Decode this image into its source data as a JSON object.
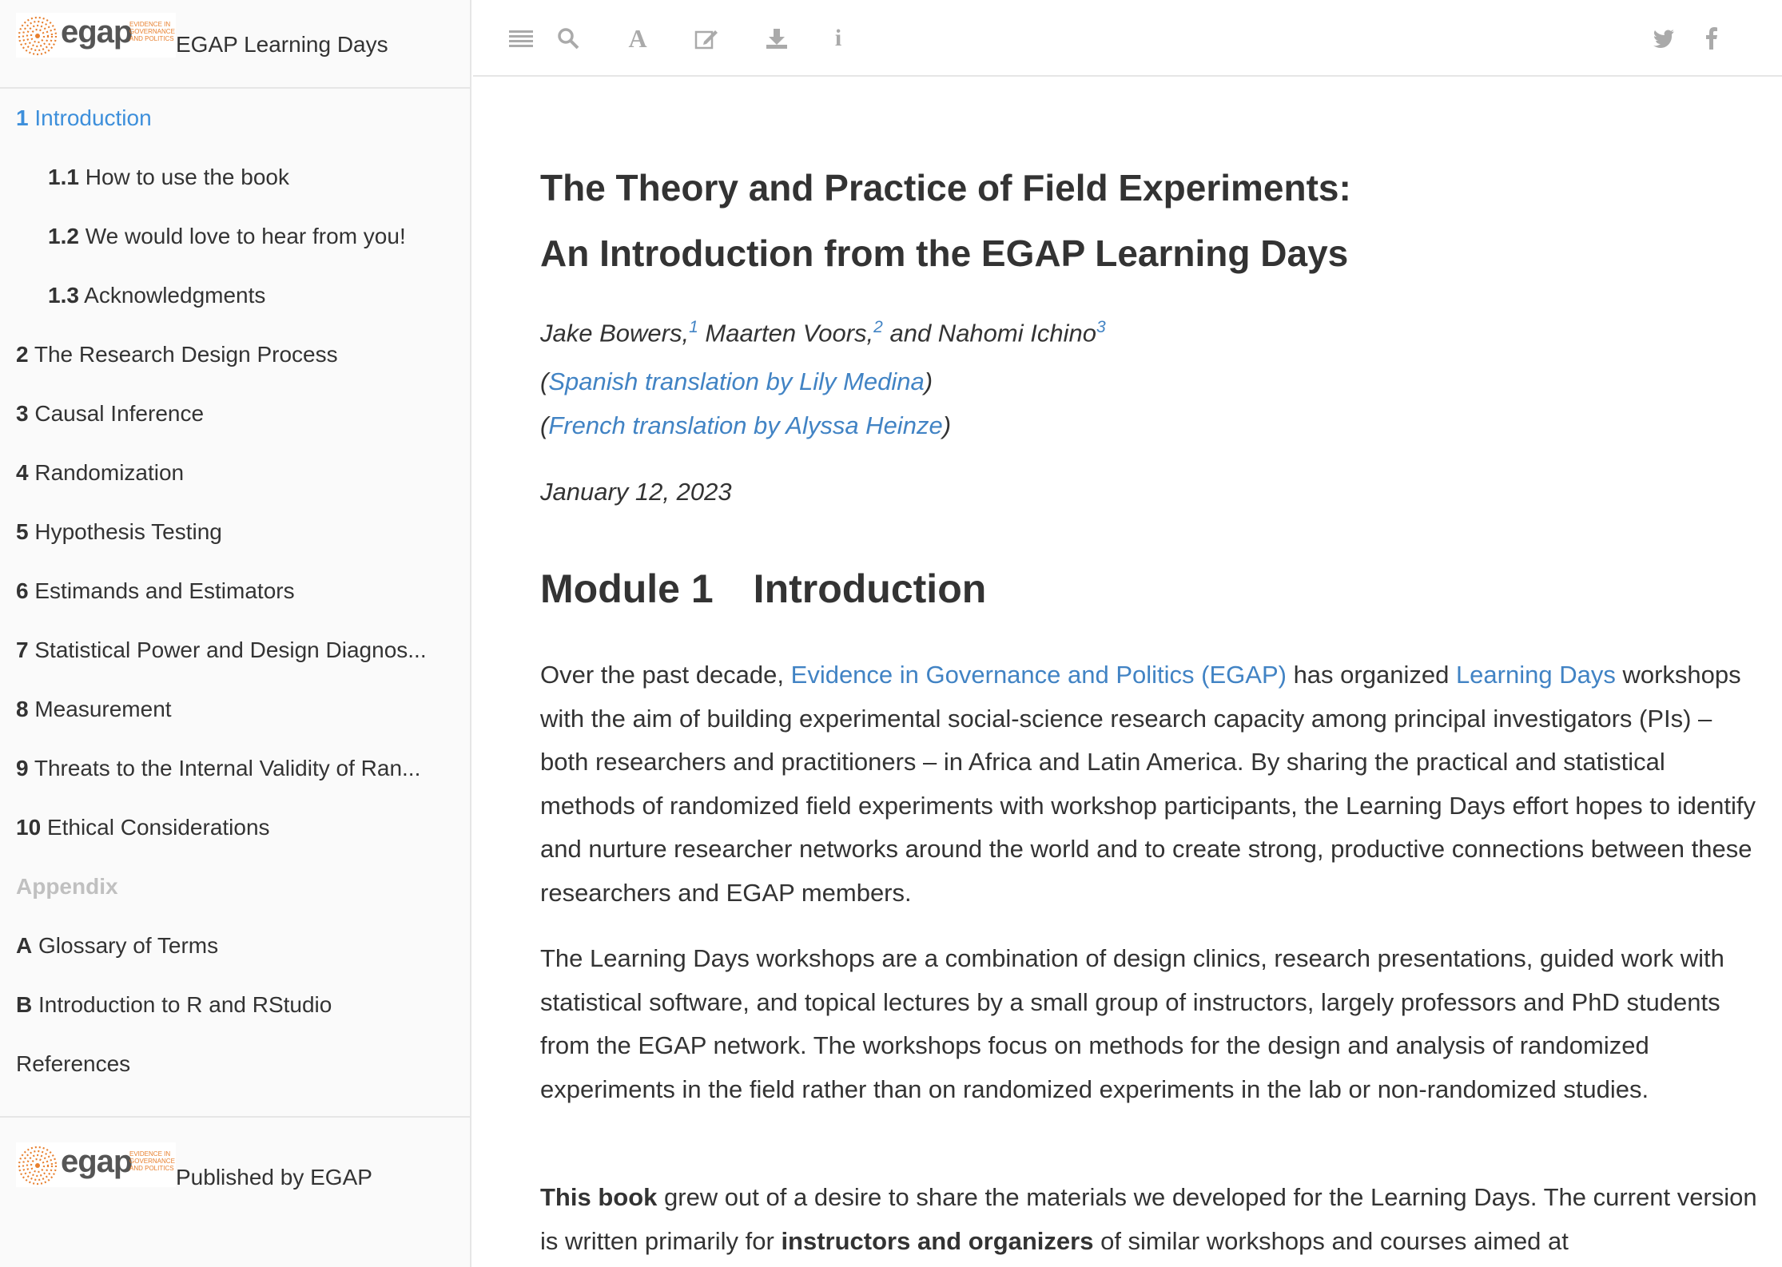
{
  "sidebar": {
    "brand_title": "EGAP Learning Days",
    "logo": {
      "word": "egap",
      "tagline": "EVIDENCE IN GOVERNANCE AND POLITICS"
    },
    "toc": [
      {
        "num": "1",
        "label": "Introduction",
        "active": true,
        "indent": false
      },
      {
        "num": "1.1",
        "label": "How to use the book",
        "indent": true
      },
      {
        "num": "1.2",
        "label": "We would love to hear from you!",
        "indent": true
      },
      {
        "num": "1.3",
        "label": "Acknowledgments",
        "indent": true
      },
      {
        "num": "2",
        "label": "The Research Design Process"
      },
      {
        "num": "3",
        "label": "Causal Inference"
      },
      {
        "num": "4",
        "label": "Randomization"
      },
      {
        "num": "5",
        "label": "Hypothesis Testing"
      },
      {
        "num": "6",
        "label": "Estimands and Estimators"
      },
      {
        "num": "7",
        "label": "Statistical Power and Design Diagnos..."
      },
      {
        "num": "8",
        "label": "Measurement"
      },
      {
        "num": "9",
        "label": "Threats to the Internal Validity of Ran..."
      },
      {
        "num": "10",
        "label": "Ethical Considerations"
      },
      {
        "num": "",
        "label": "Appendix",
        "muted": true
      },
      {
        "num": "A",
        "label": "Glossary of Terms"
      },
      {
        "num": "B",
        "label": "Introduction to R and RStudio"
      },
      {
        "num": "",
        "label": "References"
      }
    ],
    "published_label": "Published by EGAP"
  },
  "toolbar": {
    "left_icons": [
      "menu-icon",
      "search-icon",
      "font-icon",
      "edit-icon",
      "download-icon",
      "info-icon"
    ],
    "right_icons": [
      "twitter-icon",
      "facebook-icon"
    ]
  },
  "content": {
    "title_line1": "The Theory and Practice of Field Experiments:",
    "title_line2": "An Introduction from the EGAP Learning Days",
    "authors": [
      {
        "name": "Jake Bowers,",
        "sup": "1"
      },
      {
        "name": " Maarten Voors,",
        "sup": "2"
      },
      {
        "name": " and Nahomi Ichino",
        "sup": "3"
      }
    ],
    "translation_spanish": "Spanish translation by Lily Medina",
    "translation_french": "French translation by Alyssa Heinze",
    "date": "January 12, 2023",
    "module_heading": "Module 1 Introduction",
    "p1": {
      "before": "Over the past decade, ",
      "link1": "Evidence in Governance and Politics (EGAP)",
      "mid": " has organized ",
      "link2": "Learning Days",
      "after": " workshops with the aim of building experimental social-science research capacity among principal investigators (PIs) – both researchers and practitioners – in Africa and Latin America. By sharing the practical and statistical methods of randomized field experiments with workshop participants, the Learning Days effort hopes to identify and nurture researcher networks around the world and to create strong, productive connections between these researchers and EGAP members."
    },
    "p2": "The Learning Days workshops are a combination of design clinics, research presentations, guided work with statistical software, and topical lectures by a small group of instructors, largely professors and PhD students from the EGAP network. The workshops focus on methods for the design and analysis of randomized experiments in the field rather than on randomized experiments in the lab or non-randomized studies.",
    "p3": {
      "bold1": "This book",
      "text1": " grew out of a desire to share the materials we developed for the Learning Days. The current version is written primarily for ",
      "bold2": "instructors and organizers",
      "text2": " of similar workshops and courses aimed at"
    }
  },
  "colors": {
    "link": "#4183c4",
    "active": "#3d8fdb",
    "logo_orange": "#e8802f"
  }
}
